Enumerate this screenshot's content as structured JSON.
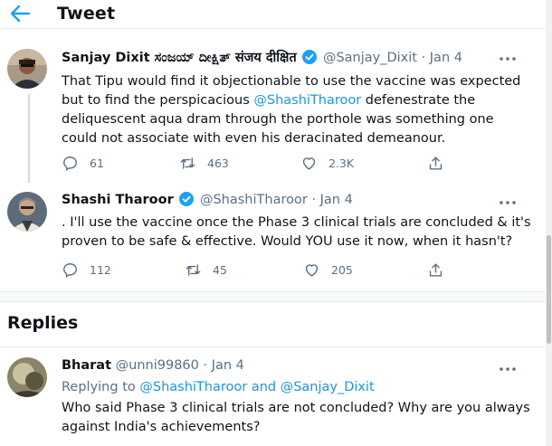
{
  "header": {
    "title": "Tweet",
    "back_icon": "arrow-left-icon"
  },
  "accent_color": "#1da1f2",
  "tweets": [
    {
      "name": "Sanjay Dixit ಸಂಜಯ್ ದೀಕ್ಷಿತ್ संजय दीक्षित",
      "handle": "@Sanjay_Dixit",
      "date": "Jan 4",
      "verified": true,
      "text_part1": "That Tipu would find it objectionable to use the vaccine was expected but to find the perspicacious ",
      "mention": "@ShashiTharoor",
      "text_part2": " defenestrate the deliquescent aqua dram through the porthole was something one could not associate with even his deracinated demeanour.",
      "replies": "61",
      "retweets": "463",
      "likes": "2.3K"
    },
    {
      "name": "Shashi Tharoor",
      "handle": "@ShashiTharoor",
      "date": "Jan 4",
      "verified": true,
      "text": ". I'll use the vaccine once the Phase 3 clinical trials are concluded & it's proven to be safe & effective. Would YOU use it now, when it hasn't?",
      "replies": "112",
      "retweets": "45",
      "likes": "205"
    }
  ],
  "replies_section": {
    "title": "Replies",
    "reply": {
      "name": "Bharat",
      "handle": "@unni99860",
      "date": "Jan 4",
      "replying_prefix": "Replying to",
      "replying_mention1": "@ShashiTharoor",
      "replying_and": "and",
      "replying_mention2": "@Sanjay_Dixit",
      "text": "Who said Phase 3 clinical trials are not concluded? Why are you always against India's achievements?"
    }
  },
  "dot": "·"
}
